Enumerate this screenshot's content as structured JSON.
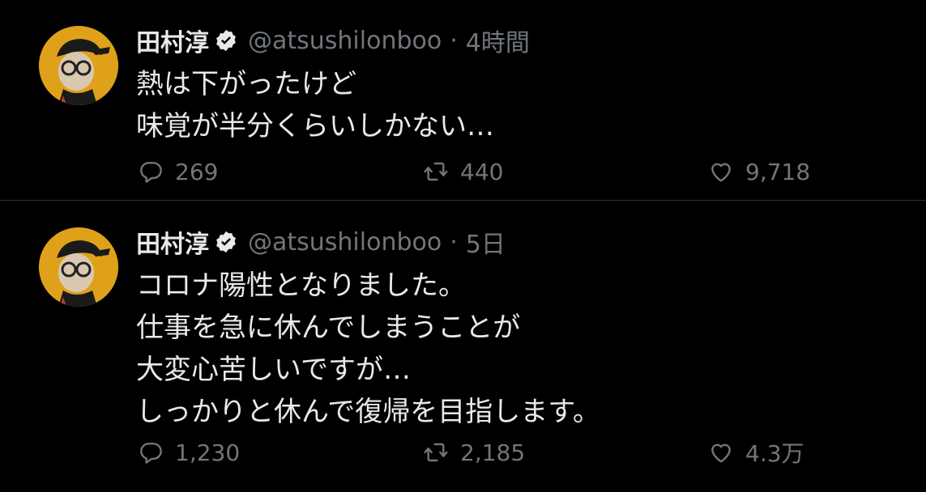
{
  "tweets": [
    {
      "display_name": "田村淳",
      "handle": "@atsushilonboo",
      "separator": "·",
      "time": "4時間",
      "lines": [
        "熱は下がったけど",
        "味覚が半分くらいしかない…"
      ],
      "replies": "269",
      "retweets": "440",
      "likes": "9,718"
    },
    {
      "display_name": "田村淳",
      "handle": "@atsushilonboo",
      "separator": "·",
      "time": "5日",
      "lines": [
        "コロナ陽性となりました。",
        "仕事を急に休んでしまうことが",
        "大変心苦しいですが…",
        "しっかりと休んで復帰を目指します。"
      ],
      "replies": "1,230",
      "retweets": "2,185",
      "likes": "4.3万"
    }
  ],
  "icons": {
    "avatar": "avatar-illustration",
    "verified": "verified-badge-icon",
    "reply": "reply-icon",
    "retweet": "retweet-icon",
    "like": "heart-icon"
  },
  "colors": {
    "background": "#000000",
    "text": "#e7e9ea",
    "muted": "#71767b",
    "divider": "#2f3336",
    "avatar_bg": "#e0a11a"
  }
}
